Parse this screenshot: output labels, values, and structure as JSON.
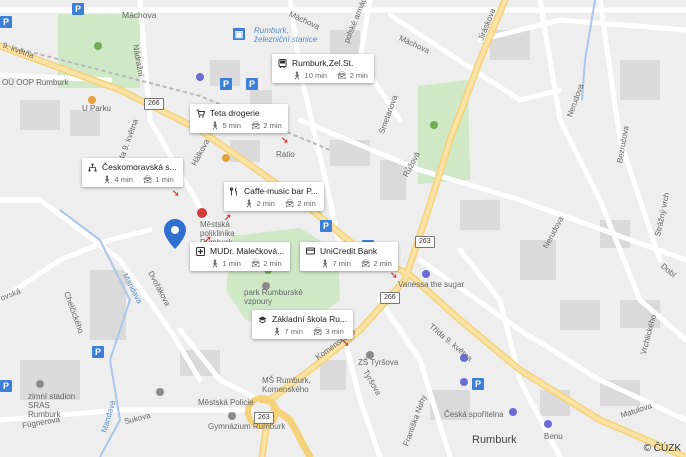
{
  "map": {
    "streets": {
      "machova_top": "Máchova",
      "machova_right": "Máchova",
      "nadrazni": "Nádražní",
      "trida9kvetna_left": "9. května",
      "trida9kvetna_mid": "Třída 9. května",
      "halkova": "Hálkova",
      "polska_armady": "polské armády",
      "jirasekova": "Jiráskova",
      "smetanova": "Smetanova",
      "ruzova": "Růžová",
      "nerudova": "Nerudova",
      "bezrucova": "Bezručova",
      "neruda2": "Nerudova",
      "strazny_vrch": "Strážný vrch",
      "dobi": "Dobí",
      "vrchlickeho": "Vrchlického",
      "komenskeho": "Komenského",
      "tyrsova": "Tyršova",
      "trida9kvetna_low": "Třída 9. května",
      "frantiska_nohy": "Františka Nohy",
      "matulova": "Matulova",
      "sukova": "Sukova",
      "fugnerova": "Fügnerova",
      "dvorakova": "Dvořákova",
      "chelcickeho": "Chelčického",
      "mandava": "Mandava",
      "mandava2": "Mandava",
      "lipova": "ovská"
    },
    "places": {
      "rumburk_zel_stanice": "Rumburk, železniční stanice",
      "ou_pp": "OÚ OOP Rumburk",
      "u_parku": "U Parku",
      "ratio": "Ratio",
      "poliklinika": "Městská poliklinika Rumburk",
      "park_rumburske_vzpoury": "park Rumburské vzpoury",
      "vanessa": "Vanessa the sugar",
      "zimni_stadion": "zimní stadion SRAS Rumburk",
      "mestska_policie": "Městská Policie",
      "gymnazium": "Gymnázium Rumburk",
      "ms_rumburk": "MŠ Rumburk, Komenského",
      "zs_tyrsova": "ZŠ Tyršova",
      "ceska_sporitelna": "Česká spořitelna",
      "benu": "Benu",
      "rumburk": "Rumburk"
    },
    "road_numbers": [
      "266",
      "263",
      "266",
      "263"
    ],
    "copyright": "© ČÚZK"
  },
  "callouts": [
    {
      "name": "Rumburk,Zel.St.",
      "icon": "bus-icon",
      "walk": "10 min",
      "car": "2 min"
    },
    {
      "name": "Teta drogerie",
      "icon": "cart-icon",
      "walk": "5 min",
      "car": "2 min"
    },
    {
      "name": "Českomoravská s...",
      "icon": "org-icon",
      "walk": "4 min",
      "car": "1 min"
    },
    {
      "name": "Caffe-music bar P...",
      "icon": "fork-knife-icon",
      "walk": "2 min",
      "car": "2 min"
    },
    {
      "name": "MUDr. Malečková...",
      "icon": "medical-icon",
      "walk": "1 min",
      "car": "2 min"
    },
    {
      "name": "UniCredit Bank",
      "icon": "bank-icon",
      "walk": "7 min",
      "car": "2 min"
    },
    {
      "name": "Základní škola Ru...",
      "icon": "school-icon",
      "walk": "7 min",
      "car": "3 min"
    }
  ]
}
